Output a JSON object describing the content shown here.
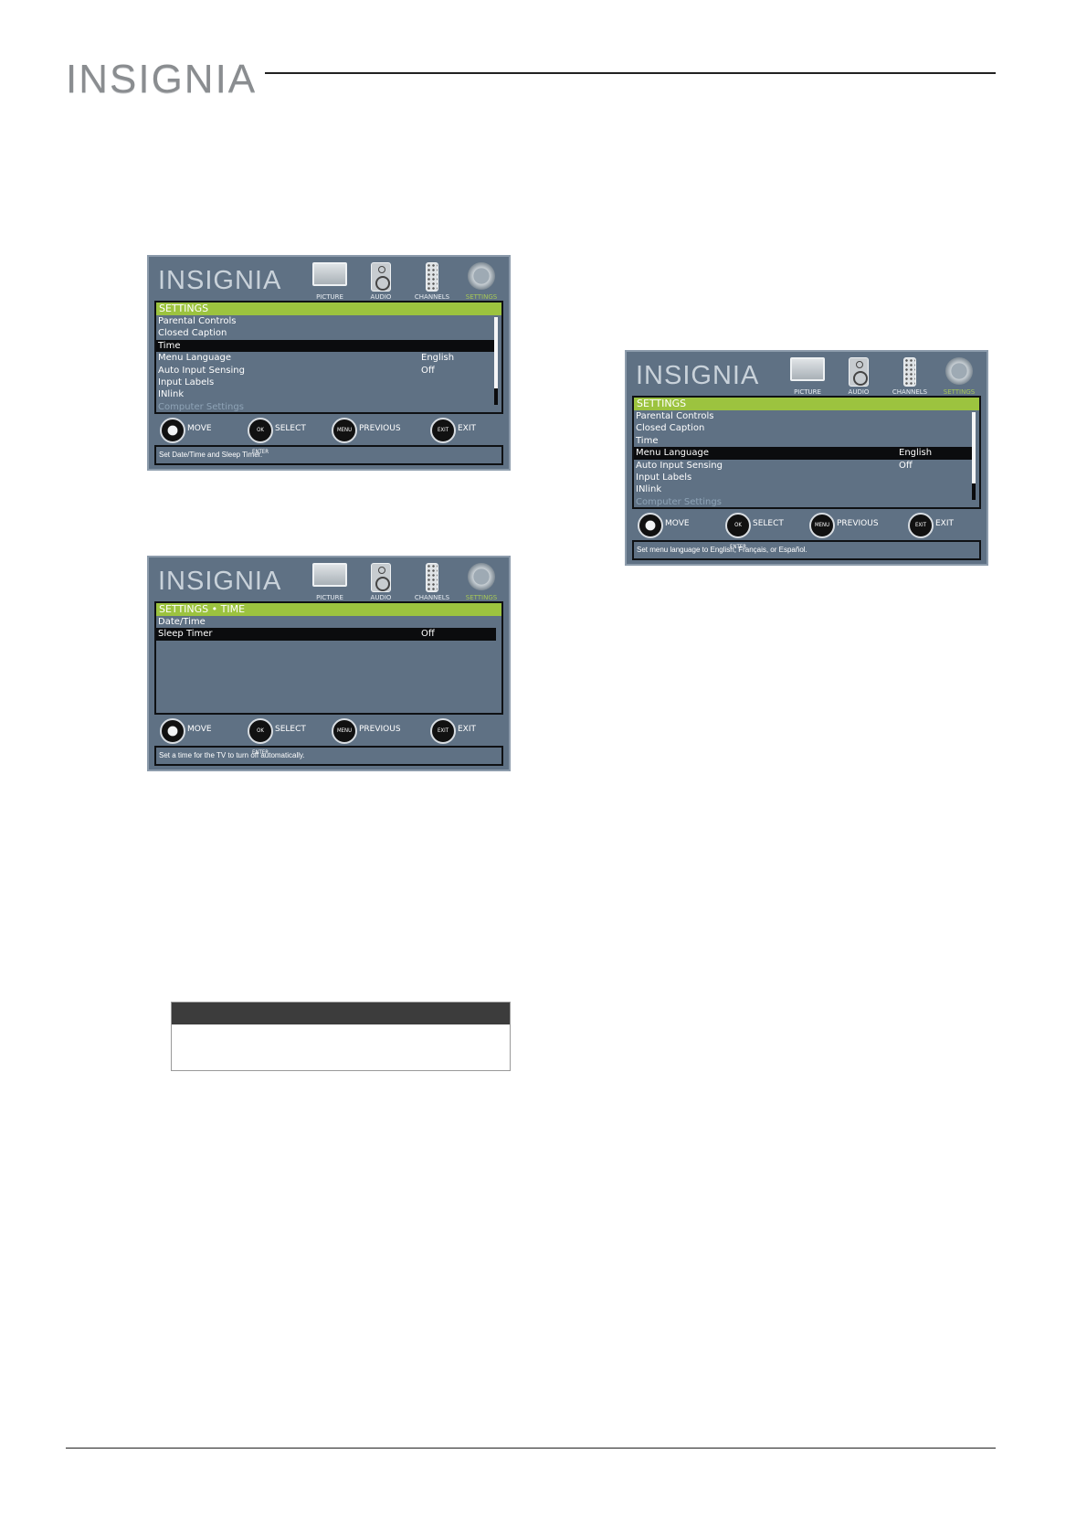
{
  "page": {
    "logo": "INSIGNIA"
  },
  "screens": [
    {
      "brand": "INSIGNIA",
      "tabs": [
        "PICTURE",
        "AUDIO",
        "CHANNELS",
        "SETTINGS"
      ],
      "panel_title": "SETTINGS",
      "rows": [
        {
          "label": "Parental Controls",
          "value": ""
        },
        {
          "label": "Closed Caption",
          "value": ""
        },
        {
          "label": "Time",
          "value": ""
        },
        {
          "label": "Menu Language",
          "value": "English"
        },
        {
          "label": "Auto Input Sensing",
          "value": "Off"
        },
        {
          "label": "Input Labels",
          "value": ""
        },
        {
          "label": "INlink",
          "value": ""
        },
        {
          "label": "Computer Settings",
          "value": ""
        }
      ],
      "selected_row": 2,
      "nav": {
        "move": "MOVE",
        "ok": "OK ENTER",
        "select": "SELECT",
        "menu": "MENU",
        "previous": "PREVIOUS",
        "exit_btn": "EXIT",
        "exit": "EXIT"
      },
      "help": "Set Date/Time and Sleep Timer."
    },
    {
      "brand": "INSIGNIA",
      "tabs": [
        "PICTURE",
        "AUDIO",
        "CHANNELS",
        "SETTINGS"
      ],
      "panel_title": "SETTINGS • TIME",
      "rows": [
        {
          "label": "Date/Time",
          "value": ""
        },
        {
          "label": "Sleep Timer",
          "value": "Off"
        }
      ],
      "selected_row": 1,
      "nav": {
        "move": "MOVE",
        "ok": "OK ENTER",
        "select": "SELECT",
        "menu": "MENU",
        "previous": "PREVIOUS",
        "exit_btn": "EXIT",
        "exit": "EXIT"
      },
      "help": "Set a time for the TV to turn off automatically."
    },
    {
      "brand": "INSIGNIA",
      "tabs": [
        "PICTURE",
        "AUDIO",
        "CHANNELS",
        "SETTINGS"
      ],
      "panel_title": "SETTINGS",
      "rows": [
        {
          "label": "Parental Controls",
          "value": ""
        },
        {
          "label": "Closed Caption",
          "value": ""
        },
        {
          "label": "Time",
          "value": ""
        },
        {
          "label": "Menu Language",
          "value": "English"
        },
        {
          "label": "Auto Input Sensing",
          "value": "Off"
        },
        {
          "label": "Input Labels",
          "value": ""
        },
        {
          "label": "INlink",
          "value": ""
        },
        {
          "label": "Computer Settings",
          "value": ""
        }
      ],
      "selected_row": 3,
      "nav": {
        "move": "MOVE",
        "ok": "OK ENTER",
        "select": "SELECT",
        "menu": "MENU",
        "previous": "PREVIOUS",
        "exit_btn": "EXIT",
        "exit": "EXIT"
      },
      "help": "Set menu language to English, Français, or Español."
    }
  ]
}
